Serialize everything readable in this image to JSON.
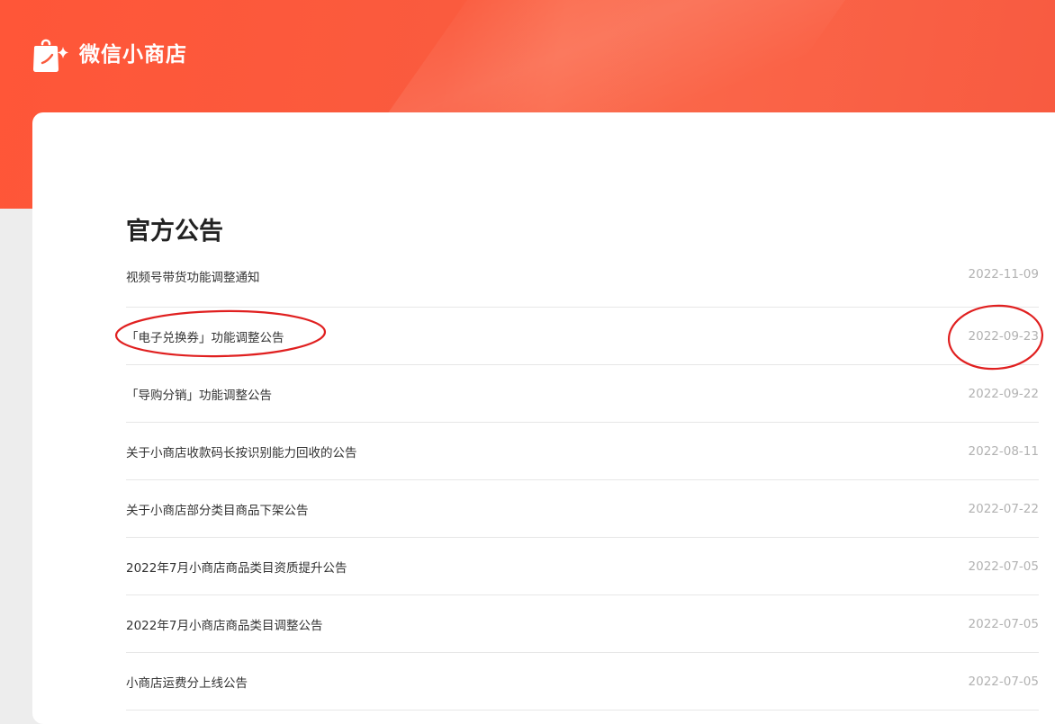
{
  "brand": {
    "title": "微信小商店",
    "logo_icon": "shopping-bag-sparkle-icon"
  },
  "notices": {
    "title": "官方公告",
    "items": [
      {
        "title": "视频号带货功能调整通知",
        "date": "2022-11-09"
      },
      {
        "title": "「电子兑换券」功能调整公告",
        "date": "2022-09-23"
      },
      {
        "title": "「导购分销」功能调整公告",
        "date": "2022-09-22"
      },
      {
        "title": "关于小商店收款码长按识别能力回收的公告",
        "date": "2022-08-11"
      },
      {
        "title": "关于小商店部分类目商品下架公告",
        "date": "2022-07-22"
      },
      {
        "title": "2022年7月小商店商品类目资质提升公告",
        "date": "2022-07-05"
      },
      {
        "title": "2022年7月小商店商品类目调整公告",
        "date": "2022-07-05"
      },
      {
        "title": "小商店运费分上线公告",
        "date": "2022-07-05"
      }
    ]
  },
  "colors": {
    "brand_orange": "#fa5b3e",
    "annotation_red": "#e02020"
  }
}
